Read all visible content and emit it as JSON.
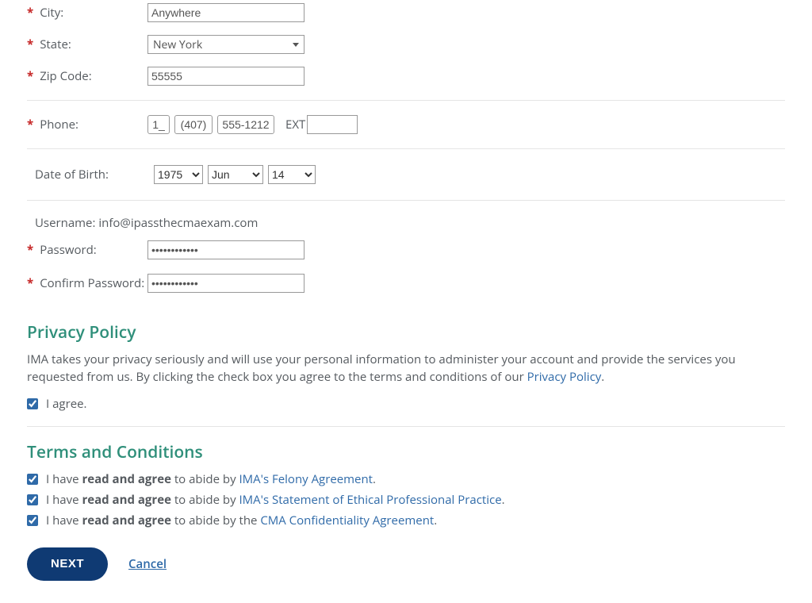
{
  "form": {
    "city": {
      "label": "City:",
      "value": "Anywhere"
    },
    "state": {
      "label": "State:",
      "value": "New York"
    },
    "zip": {
      "label": "Zip Code:",
      "value": "55555"
    },
    "phone": {
      "label": "Phone:",
      "cc": "1_",
      "area": "(407)",
      "number": "555-1212",
      "ext_label": "EXT",
      "ext_value": ""
    },
    "dob": {
      "label": "Date of Birth:",
      "year": "1975",
      "month": "Jun",
      "day": "14"
    },
    "username": {
      "label": "Username:",
      "value": "info@ipassthecmaexam.com"
    },
    "password": {
      "label": "Password:",
      "value": "••••••••••••"
    },
    "confirm_password": {
      "label": "Confirm Password:",
      "value": "••••••••••••"
    }
  },
  "privacy": {
    "heading": "Privacy Policy",
    "text_before_link": "IMA takes your privacy seriously and will use your personal information to administer your account and provide the services you requested from us. By clicking the check box you agree to the terms and conditions of our ",
    "link_text": "Privacy Policy",
    "period": ".",
    "agree_label": "I agree."
  },
  "terms": {
    "heading": "Terms and Conditions",
    "prefix": "I have ",
    "strong": "read and agree",
    "mid": " to abide by ",
    "mid_the": " to abide by the ",
    "items": [
      {
        "link": "IMA's Felony Agreement"
      },
      {
        "link": "IMA's Statement of Ethical Professional Practice"
      },
      {
        "link": "CMA Confidentiality Agreement"
      }
    ],
    "period": "."
  },
  "actions": {
    "next": "NEXT",
    "cancel": "Cancel"
  }
}
